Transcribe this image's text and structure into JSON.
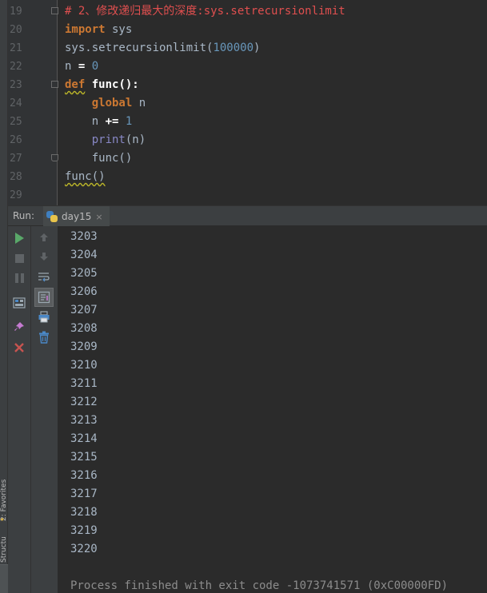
{
  "editor": {
    "lines": [
      {
        "num": "19",
        "comment": "# 2、修改递归最大的深度:sys.setrecursionlimit"
      },
      {
        "num": "20",
        "kw": "import",
        "rest": " sys"
      },
      {
        "num": "21",
        "call": "sys.setrecursionlimit(",
        "arg": "100000",
        "close": ")"
      },
      {
        "num": "22",
        "var": "n",
        "op": "=",
        "val": "0"
      },
      {
        "num": "23",
        "kw": "def",
        "fname": "func",
        "tail": "():"
      },
      {
        "num": "24",
        "kw": "global",
        "rest": " n"
      },
      {
        "num": "25",
        "var": "n",
        "op": "+=",
        "val": "1"
      },
      {
        "num": "26",
        "bi": "print",
        "args": "(n)"
      },
      {
        "num": "27",
        "call": "func()"
      },
      {
        "num": "28",
        "call": "func()"
      },
      {
        "num": "29"
      }
    ]
  },
  "run": {
    "label": "Run:",
    "tab_label": "day15",
    "tab_close": "×"
  },
  "console": {
    "lines": [
      "3203",
      "3204",
      "3205",
      "3206",
      "3207",
      "3208",
      "3209",
      "3210",
      "3211",
      "3212",
      "3213",
      "3214",
      "3215",
      "3216",
      "3217",
      "3218",
      "3219",
      "3220"
    ],
    "exit_message": "Process finished with exit code -1073741571 (0xC00000FD)"
  },
  "left_strip": {
    "favorites": "2: Favorites",
    "structure": "Structure"
  },
  "icons": {
    "toolbar_left": [
      "run-icon",
      "stop-icon",
      "pause-icon",
      "layout-icon",
      "pin-icon",
      "close-icon"
    ],
    "toolbar_right": [
      "up-arrow-icon",
      "down-arrow-icon",
      "soft-wrap-icon",
      "scroll-to-end-icon",
      "print-icon",
      "trash-icon"
    ]
  },
  "colors": {
    "accent_run": "#59a869",
    "close": "#c75450",
    "comment": "#e04f4f",
    "keyword": "#cc7832",
    "number": "#6897bb",
    "builtin": "#8888c6"
  }
}
